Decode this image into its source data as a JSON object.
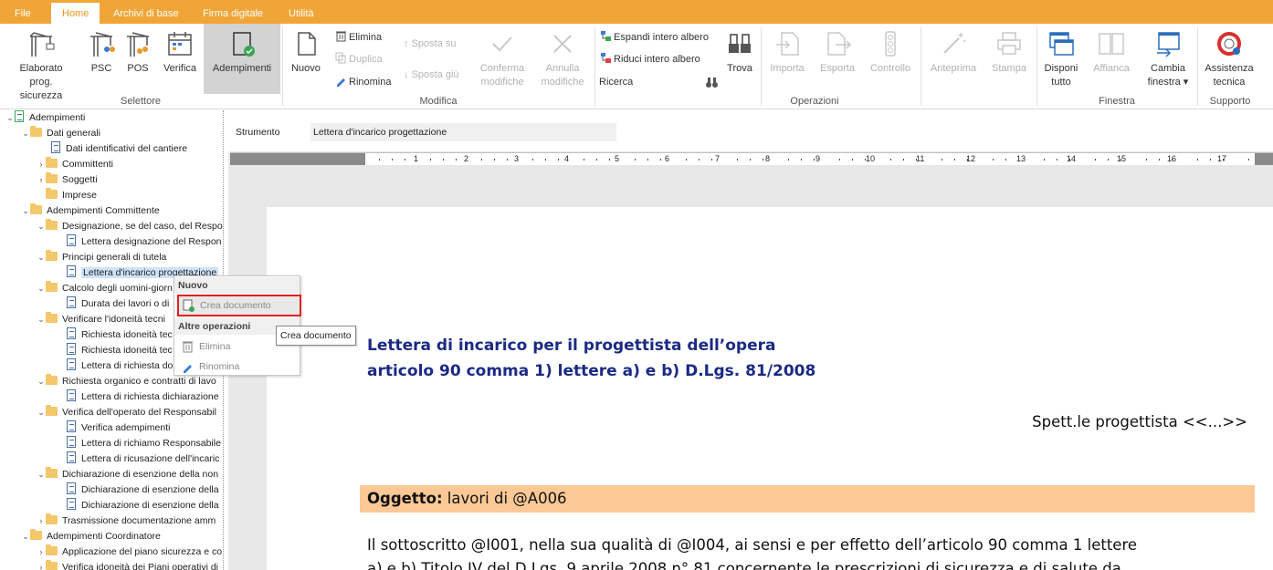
{
  "menu": {
    "tabs": [
      "File",
      "Home",
      "Archivi di base",
      "Firma digitale",
      "Utilità"
    ]
  },
  "ribbon": {
    "selettore": {
      "elaborato": "Elaborato\nprog. sicurezza",
      "elaborato_l1": "Elaborato",
      "elaborato_l2": "prog. sicurezza",
      "psc": "PSC",
      "pos": "POS",
      "verifica": "Verifica",
      "adempimenti": "Adempimenti",
      "group": "Selettore"
    },
    "modifica": {
      "nuovo": "Nuovo",
      "elimina": "Elimina",
      "duplica": "Duplica",
      "rinomina": "Rinomina",
      "sposta_su": "Sposta su",
      "sposta_giu": "Sposta giù",
      "conferma_l1": "Conferma",
      "conferma_l2": "modifiche",
      "annulla_l1": "Annulla",
      "annulla_l2": "modifiche",
      "group": "Modifica"
    },
    "operazioni": {
      "espandi": "Espandi intero albero",
      "riduci": "Riduci intero albero",
      "ricerca": "Ricerca",
      "trova": "Trova",
      "importa": "Importa",
      "esporta": "Esporta",
      "controllo": "Controllo",
      "anteprima": "Anteprima",
      "stampa": "Stampa",
      "group": "Operazioni"
    },
    "finestra": {
      "disponi_l1": "Disponi",
      "disponi_l2": "tutto",
      "affianca": "Affianca",
      "cambia_l1": "Cambia",
      "cambia_l2": "finestra ▾",
      "group": "Finestra"
    },
    "supporto": {
      "assistenza_l1": "Assistenza",
      "assistenza_l2": "tecnica",
      "group": "Supporto"
    }
  },
  "tree": {
    "items": [
      {
        "label": "Adempimenti",
        "level": 0,
        "type": "root",
        "expanded": true
      },
      {
        "label": "Dati generali",
        "level": 1,
        "type": "folder",
        "expanded": true
      },
      {
        "label": "Dati identificativi del cantiere",
        "level": 2,
        "type": "doc"
      },
      {
        "label": "Committenti",
        "level": 2,
        "type": "folder",
        "expanded": false
      },
      {
        "label": "Soggetti",
        "level": 2,
        "type": "folder",
        "expanded": false
      },
      {
        "label": "Imprese",
        "level": 2,
        "type": "folder",
        "leaf": true
      },
      {
        "label": "Adempimenti Committente",
        "level": 1,
        "type": "folder",
        "expanded": true
      },
      {
        "label": "Designazione, se del caso, del Respo",
        "level": 2,
        "type": "folder",
        "expanded": true
      },
      {
        "label": "Lettera designazione del Respon",
        "level": 3,
        "type": "doc"
      },
      {
        "label": "Principi generali di tutela",
        "level": 2,
        "type": "folder",
        "expanded": true
      },
      {
        "label": "Lettera d'incarico progettazione",
        "level": 3,
        "type": "doc",
        "selected": true
      },
      {
        "label": "Calcolo degli uomini-giorn",
        "level": 2,
        "type": "folder",
        "expanded": true
      },
      {
        "label": "Durata dei lavori o di",
        "level": 3,
        "type": "doc"
      },
      {
        "label": "Verificare l'idoneità tecni",
        "level": 2,
        "type": "folder",
        "expanded": true
      },
      {
        "label": "Richiesta idoneità tec",
        "level": 3,
        "type": "doc"
      },
      {
        "label": "Richiesta idoneità tec",
        "level": 3,
        "type": "doc"
      },
      {
        "label": "Lettera di richiesta do",
        "level": 3,
        "type": "doc"
      },
      {
        "label": "Richiesta organico e contratti di lavo",
        "level": 2,
        "type": "folder",
        "expanded": true
      },
      {
        "label": "Lettera di richiesta dichiarazione",
        "level": 3,
        "type": "doc"
      },
      {
        "label": "Verifica dell'operato del Responsabil",
        "level": 2,
        "type": "folder",
        "expanded": true
      },
      {
        "label": "Verifica adempimenti",
        "level": 3,
        "type": "doc"
      },
      {
        "label": "Lettera di richiamo Responsabile",
        "level": 3,
        "type": "doc"
      },
      {
        "label": "Lettera di ricusazione dell'incaric",
        "level": 3,
        "type": "doc"
      },
      {
        "label": "Dichiarazione di esenzione della non",
        "level": 2,
        "type": "folder",
        "expanded": true
      },
      {
        "label": "Dichiarazione di esenzione della",
        "level": 3,
        "type": "doc"
      },
      {
        "label": "Dichiarazione di esenzione della",
        "level": 3,
        "type": "doc"
      },
      {
        "label": "Trasmissione documentazione amm",
        "level": 2,
        "type": "folder",
        "expanded": false
      },
      {
        "label": "Adempimenti Coordinatore",
        "level": 1,
        "type": "folder",
        "expanded": true
      },
      {
        "label": "Applicazione del piano sicurezza e co",
        "level": 2,
        "type": "folder",
        "expanded": false
      },
      {
        "label": "Verifica idoneità dei Piani operativi di",
        "level": 2,
        "type": "folder",
        "expanded": false
      }
    ]
  },
  "context_menu": {
    "header_nuovo": "Nuovo",
    "crea": "Crea documento",
    "header_altre": "Altre operazioni",
    "elimina": "Elimina",
    "rinomina": "Rinomina"
  },
  "tooltip": "Crea documento",
  "editor": {
    "strumento_label": "Strumento",
    "strumento_value": "Lettera d'incarico progettazione",
    "ruler_numbers": [
      "1",
      "2",
      "3",
      "4",
      "5",
      "6",
      "7",
      "8",
      "9",
      "10",
      "11",
      "12",
      "13",
      "14",
      "15",
      "16",
      "17"
    ],
    "title_l1": "Lettera di incarico per il progettista dell’opera",
    "title_l2": "articolo 90 comma 1) lettere a) e b) D.Lgs. 81/2008",
    "spett": "Spett.le progettista <<...>>",
    "oggetto_label": "Oggetto:",
    "oggetto_text": " lavori di @A006",
    "body_l1": "Il sottoscritto @I001, nella sua qualità di @I004, ai sensi e per effetto dell’articolo 90 comma 1 lettere",
    "body_l2": "a) e b) Titolo IV del D.Lgs. 9 aprile 2008 n° 81 concernente le prescrizioni di sicurezza e di salute da"
  },
  "colors": {
    "menubar": "#f0a637",
    "title_blue": "#1b2a84",
    "oggetto_bg": "#fcc996",
    "highlight_border": "#e02020"
  }
}
